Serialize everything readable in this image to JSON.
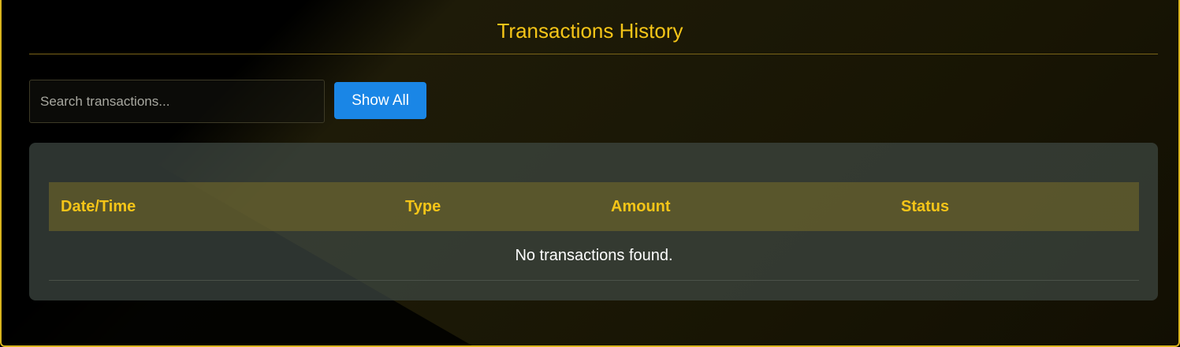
{
  "header": {
    "title": "Transactions History"
  },
  "controls": {
    "search_placeholder": "Search transactions...",
    "search_value": "",
    "show_all_label": "Show All"
  },
  "table": {
    "columns": [
      "Date/Time",
      "Type",
      "Amount",
      "Status"
    ],
    "rows": [],
    "empty_message": "No transactions found."
  },
  "colors": {
    "accent": "#f5c518",
    "button": "#1a86e6",
    "border": "#d9b41d"
  }
}
